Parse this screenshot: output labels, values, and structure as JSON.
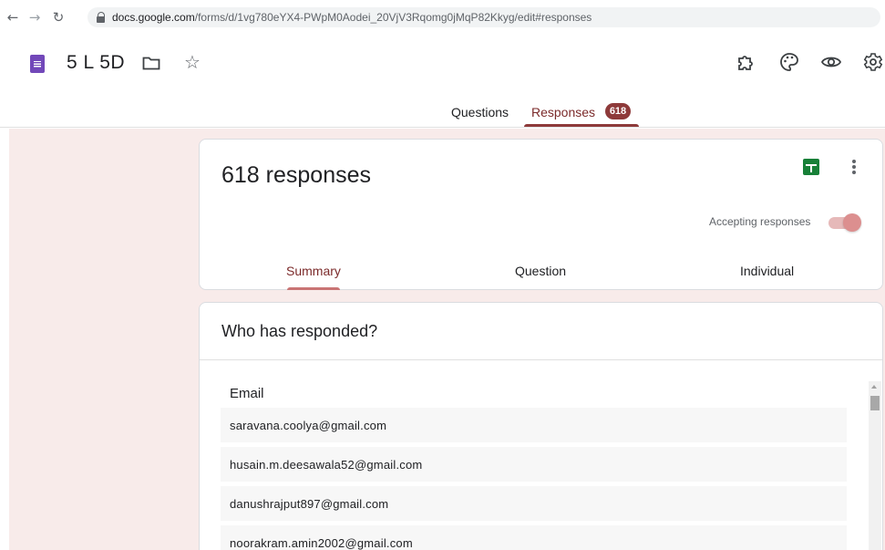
{
  "browser": {
    "url_host": "docs.google.com",
    "url_path": "/forms/d/1vg780eYX4-PWpM0Aodei_20VjV3Rqomg0jMqP82Kkyg/edit#responses"
  },
  "header": {
    "title": "5 L 5D"
  },
  "tabs": {
    "questions": "Questions",
    "responses": "Responses",
    "responses_count": "618"
  },
  "summary_card": {
    "title": "618 responses",
    "accepting_label": "Accepting responses",
    "accepting_on": true,
    "subtabs": [
      "Summary",
      "Question",
      "Individual"
    ]
  },
  "who_card": {
    "title": "Who has responded?",
    "column_header": "Email",
    "emails": [
      "saravana.coolya@gmail.com",
      "husain.m.deesawala52@gmail.com",
      "danushrajput897@gmail.com",
      "noorakram.amin2002@gmail.com"
    ]
  },
  "colors": {
    "accent": "#8e3a3a",
    "background": "#f8ebea",
    "forms_purple": "#7248b9",
    "sheets_green": "#188038"
  }
}
